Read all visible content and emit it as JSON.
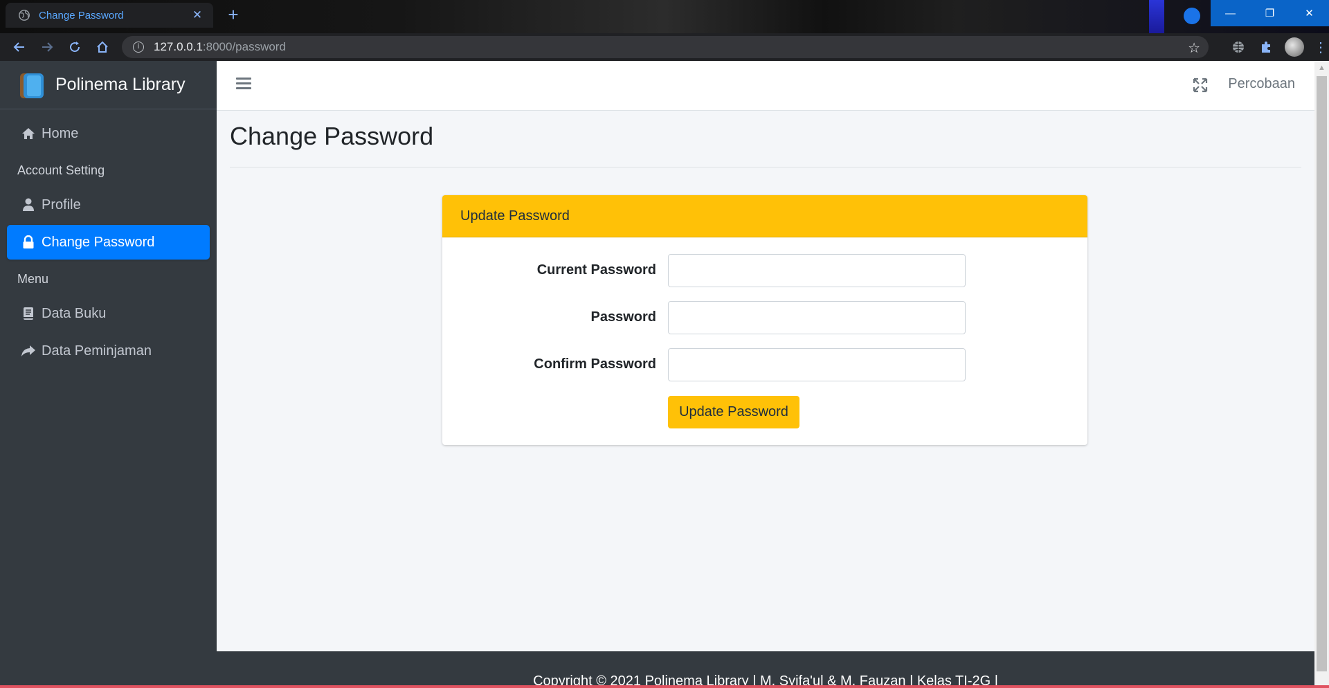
{
  "browser": {
    "tab_title": "Change Password",
    "url_host": "127.0.0.1",
    "url_path": ":8000/password"
  },
  "sidebar": {
    "brand": "Polinema Library",
    "items": [
      {
        "label": "Home",
        "icon": "home-icon"
      },
      {
        "header": "Account Setting"
      },
      {
        "label": "Profile",
        "icon": "user-icon"
      },
      {
        "label": "Change Password",
        "icon": "lock-icon",
        "active": true
      },
      {
        "header": "Menu"
      },
      {
        "label": "Data Buku",
        "icon": "book-icon"
      },
      {
        "label": "Data Peminjaman",
        "icon": "share-icon"
      }
    ]
  },
  "navbar": {
    "user_name": "Percobaan"
  },
  "content": {
    "page_title": "Change Password",
    "card_title": "Update Password",
    "fields": [
      {
        "label": "Current Password",
        "value": ""
      },
      {
        "label": "Password",
        "value": ""
      },
      {
        "label": "Confirm Password",
        "value": ""
      }
    ],
    "submit_label": "Update Password"
  },
  "footer": {
    "text": "Copyright © 2021 Polinema Library | M. Syifa'ul & M. Fauzan | Kelas TI-2G |"
  },
  "colors": {
    "sidebar_bg": "#343a40",
    "active": "#007bff",
    "warning": "#ffc107",
    "content_bg": "#f4f6f9"
  }
}
